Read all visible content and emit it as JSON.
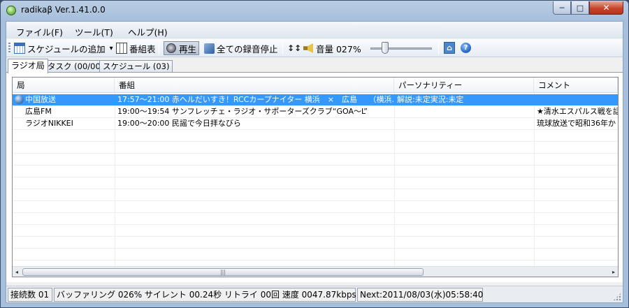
{
  "window": {
    "title": "radikaβ Ver.1.41.0.0",
    "min_glyph": "─",
    "max_glyph": "□",
    "close_glyph": "✕"
  },
  "menu": {
    "items": [
      {
        "label": "ファイル(F)"
      },
      {
        "label": "ツール(T)"
      },
      {
        "label": "ヘルプ(H)"
      }
    ]
  },
  "toolbar": {
    "add_schedule": "スケジュールの追加",
    "dropdown_glyph": "▾",
    "program_guide": "番組表",
    "play": "再生",
    "stop_all_recording": "全ての録音停止",
    "volume_label": "音量 027%",
    "volume_level": 0.27,
    "eq_glyph": "↕↕",
    "help_glyph_1": "⌂",
    "help_glyph_2": "?"
  },
  "tabs": [
    {
      "label": "ラジオ局",
      "active": true
    },
    {
      "label": "タスク (00/00)",
      "active": false
    },
    {
      "label": "スケジュール (03)",
      "active": false
    }
  ],
  "list": {
    "columns": [
      "局",
      "番組",
      "パーソナリティー",
      "コメント"
    ],
    "rows": [
      {
        "station": "中国放送",
        "program": "17:57～21:00 赤ヘルだいすき！RCCカープナイター 横浜　×　広島　　（横浜...",
        "personality": "解説:未定実況:未定",
        "comment": "",
        "selected": true,
        "icon": "radio-icon"
      },
      {
        "station": "広島FM",
        "program": "19:00～19:54 サンフレッチェ・ラジオ・サポーターズクラブ“GOA～L”",
        "personality": "",
        "comment": "★清水エスパルス戦を話",
        "selected": false
      },
      {
        "station": "ラジオNIKKEI",
        "program": "19:00～20:00 民謡で今日拝なびら",
        "personality": "",
        "comment": "琉球放送で昭和36年か",
        "selected": false
      }
    ],
    "scroll_left": "◂",
    "scroll_right": "▸",
    "thumb_grip": "|||"
  },
  "status": {
    "connections": "接続数 01",
    "buffering": "バッファリング 026% サイレント 00.24秒 リトライ 00回 速度 0047.87kbps",
    "next": "Next:2011/08/03(水)05:58:40"
  }
}
